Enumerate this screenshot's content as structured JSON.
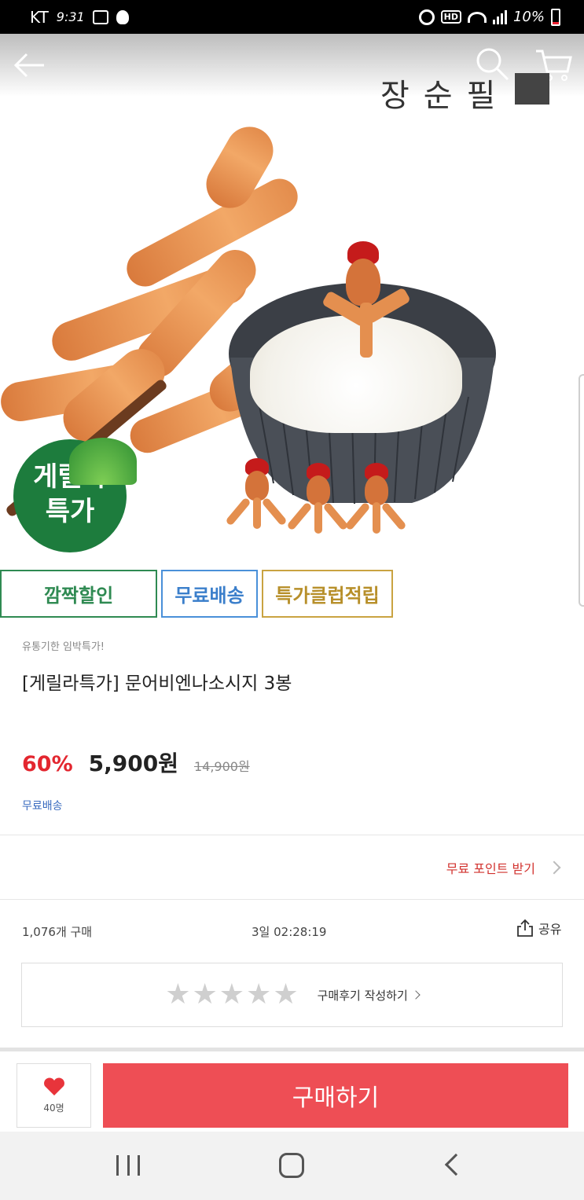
{
  "status_bar": {
    "carrier": "KT",
    "time": "9:31",
    "hd_badge": "HD",
    "battery": "10%"
  },
  "header": {
    "brand": "장순필",
    "seal_text": "장순필"
  },
  "hero": {
    "badge_line1": "게릴라",
    "badge_line2": "특가"
  },
  "tags": [
    {
      "label": "깜짝할인",
      "color": "#2f8a52"
    },
    {
      "label": "무료배송",
      "color": "#3b7fcb"
    },
    {
      "label": "특가클럽적립",
      "color": "#b78f2a"
    }
  ],
  "product": {
    "subtitle": "유통기한 임박특가!",
    "title": "[게릴라특가] 문어비엔나소시지 3봉",
    "discount": "60%",
    "price": "5,900원",
    "original_price": "14,900원",
    "shipping": "무료배송"
  },
  "points": {
    "label": "무료 포인트 받기"
  },
  "stats": {
    "purchases": "1,076개 구매",
    "timer": "3일 02:28:19",
    "share_label": "공유"
  },
  "review": {
    "rating_stars": 0,
    "label": "구매후기 작성하기"
  },
  "action_bar": {
    "like_count": "40명",
    "buy_label": "구매하기"
  },
  "colors": {
    "buy_button": "#ee4e55",
    "discount": "#e3262f",
    "badge_green": "#1d7c3d"
  }
}
